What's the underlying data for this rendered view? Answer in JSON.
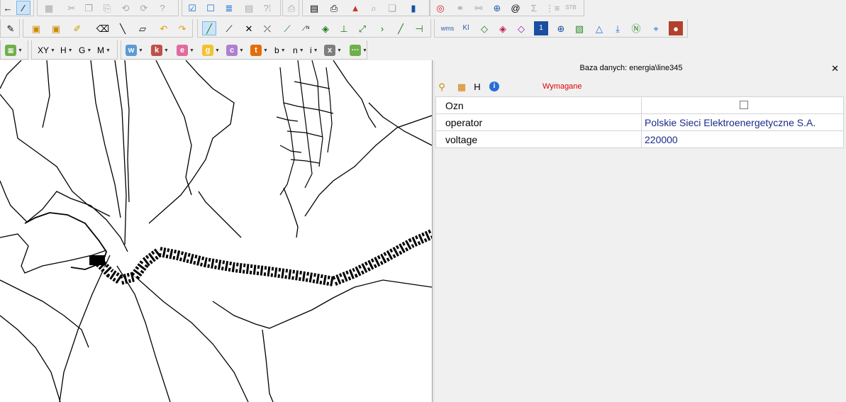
{
  "toolbar3": {
    "xy": "XY",
    "h": "H",
    "g": "G",
    "m": "M",
    "w": "w",
    "k": "k",
    "e": "e",
    "gs": "g",
    "c": "c",
    "t": "t",
    "b": "b",
    "n": "n",
    "i": "i",
    "x": "x"
  },
  "toolbar1": {
    "stb": "STB"
  },
  "toolbar2": {
    "wms": "wms",
    "kl": "Kl",
    "one": "1"
  },
  "panel": {
    "title": "Baza danych: energia\\line345",
    "h_label": "H",
    "required": "Wymagane",
    "rows": [
      {
        "key": "Ozn",
        "value": ""
      },
      {
        "key": "operator",
        "value": "Polskie Sieci Elektroenergetyczne S.A."
      },
      {
        "key": "voltage",
        "value": "220000"
      }
    ]
  },
  "colors": {
    "w": "#5b9bd5",
    "k": "#c0504d",
    "e": "#e06c9f",
    "g": "#f2c233",
    "c": "#b07fd1",
    "t": "#e46c0a",
    "x": "#7f7f7f",
    "green": "#70b04b"
  },
  "icons": [
    "ruler-icon",
    "table-icon",
    "check-icon",
    "square-icon",
    "print-icon",
    "layer-icon",
    "search-icon",
    "info-icon",
    "pin-icon",
    "globe-icon",
    "target-icon",
    "close-icon"
  ]
}
